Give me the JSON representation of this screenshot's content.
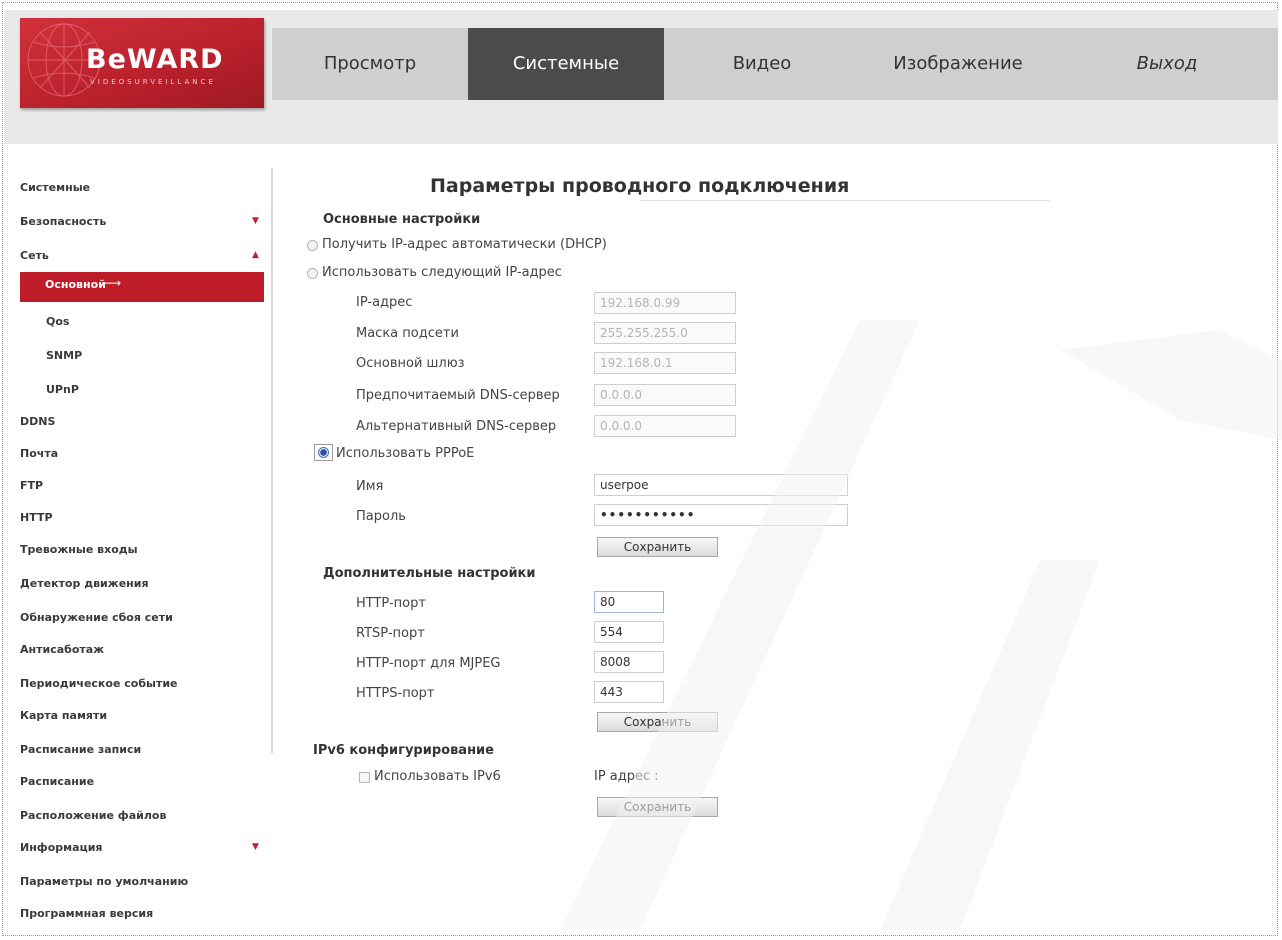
{
  "brand": {
    "logo_text": "BeWARD",
    "logo_subtext": "VIDEOSURVEILLANCE"
  },
  "topnav": [
    {
      "label": "Просмотр"
    },
    {
      "label": "Системные",
      "active": true
    },
    {
      "label": "Видео"
    },
    {
      "label": "Изображение"
    },
    {
      "label": "Выход"
    }
  ],
  "sidebar": {
    "items": [
      {
        "label": "Системные"
      },
      {
        "label": "Безопасность",
        "arrow": "▼"
      },
      {
        "label": "Сеть",
        "arrow": "▲"
      },
      {
        "label": "Основной",
        "active": true
      },
      {
        "label": "Qos"
      },
      {
        "label": "SNMP"
      },
      {
        "label": "UPnP"
      },
      {
        "label": "DDNS"
      },
      {
        "label": "Почта"
      },
      {
        "label": "FTP"
      },
      {
        "label": "HTTP"
      },
      {
        "label": "Тревожные входы"
      },
      {
        "label": "Детектор движения"
      },
      {
        "label": "Обнаружение сбоя сети"
      },
      {
        "label": "Антисаботаж"
      },
      {
        "label": "Периодическое событие"
      },
      {
        "label": "Карта памяти"
      },
      {
        "label": "Расписание записи"
      },
      {
        "label": "Расписание"
      },
      {
        "label": "Расположение файлов"
      },
      {
        "label": "Информация",
        "arrow": "▼"
      },
      {
        "label": "Параметры по умолчанию"
      },
      {
        "label": "Программная версия"
      }
    ]
  },
  "main": {
    "title": "Параметры проводного подключения",
    "basic": {
      "heading": "Основные настройки",
      "dhcp_label": "Получить IP-адрес автоматически (DHCP)",
      "static_label": "Использовать следующий IP-адрес",
      "fields": [
        {
          "label": "IP-адрес",
          "value": "192.168.0.99"
        },
        {
          "label": "Маска подсети",
          "value": "255.255.255.0"
        },
        {
          "label": "Основной шлюз",
          "value": "192.168.0.1"
        },
        {
          "label": "Предпочитаемый DNS-сервер",
          "value": "0.0.0.0"
        },
        {
          "label": "Альтернативный DNS-сервер",
          "value": "0.0.0.0"
        }
      ],
      "pppoe_label": "Использовать PPPoE",
      "pppoe_selected": true,
      "name_label": "Имя",
      "name_value": "userpoe",
      "password_label": "Пароль",
      "password_value": "•••••••••••",
      "save_label": "Сохранить"
    },
    "extra": {
      "heading": "Дополнительные настройки",
      "ports": [
        {
          "label": "HTTP-порт",
          "value": "80"
        },
        {
          "label": "RTSP-порт",
          "value": "554"
        },
        {
          "label": "HTTP-порт для MJPEG",
          "value": "8008"
        },
        {
          "label": "HTTPS-порт",
          "value": "443"
        }
      ],
      "save_label": "Сохранить"
    },
    "ipv6": {
      "heading": "IPv6 конфигурирование",
      "use_label": "Использовать IPv6",
      "ip_label": "IP адрес :",
      "save_label": "Сохранить"
    }
  },
  "colors": {
    "accent": "#bf1c2a",
    "tab_active": "#4b4b4b",
    "tab_bar": "#cfcfcf"
  }
}
